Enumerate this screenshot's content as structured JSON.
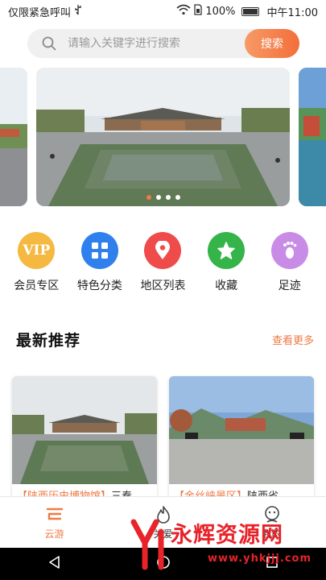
{
  "status_bar": {
    "left_text": "仅限紧急呼叫",
    "usb_icon": "usb-icon",
    "wifi_icon": "wifi-icon",
    "battery_percent": "100%",
    "time": "中午11:00"
  },
  "search": {
    "placeholder": "请输入关键字进行搜索",
    "button_label": "搜索"
  },
  "carousel": {
    "slide_count": 4,
    "active_index": 0
  },
  "categories": [
    {
      "label": "会员专区",
      "icon": "vip-icon",
      "badge_text": "VIP",
      "color": "#f5b942"
    },
    {
      "label": "特色分类",
      "icon": "grid-icon",
      "color": "#2f80ed"
    },
    {
      "label": "地区列表",
      "icon": "location-pin-icon",
      "color": "#ef4b4b"
    },
    {
      "label": "收藏",
      "icon": "star-icon",
      "color": "#34b449"
    },
    {
      "label": "足迹",
      "icon": "footprint-icon",
      "color": "#c98ce6"
    }
  ],
  "section": {
    "title": "最新推荐",
    "more_label": "查看更多"
  },
  "cards": [
    {
      "tag": "【陕西历史博物馆】",
      "rest": "三秦"
    },
    {
      "tag": "【金丝峡景区】",
      "rest": "陕西省"
    }
  ],
  "bottom_nav": [
    {
      "label": "云游",
      "icon": "cloud-tour-icon",
      "active": true
    },
    {
      "label": "关爱",
      "icon": "flame-icon",
      "active": false
    },
    {
      "label": "我的",
      "icon": "profile-icon",
      "active": false
    }
  ],
  "watermark": {
    "text": "永辉资源网",
    "url": "www.yhkjjj.com"
  },
  "colors": {
    "accent": "#f07a45",
    "search_bg": "#f0f0f0"
  }
}
